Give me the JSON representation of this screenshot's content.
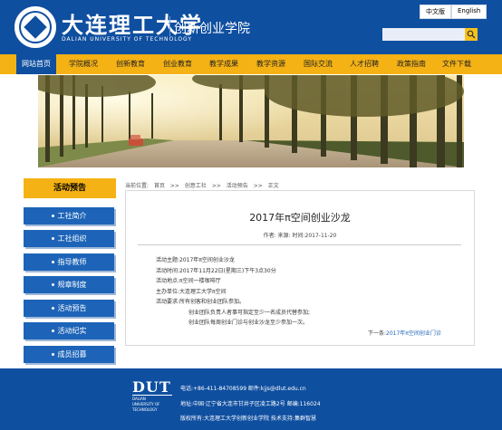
{
  "header": {
    "logo_cn": "大连理工大学",
    "logo_en": "DALIAN UNIVERSITY OF TECHNOLOGY",
    "site_name": "创新创业学院",
    "lang": [
      "中文版",
      "English"
    ],
    "search_placeholder": ""
  },
  "nav": {
    "items": [
      "网站首页",
      "学院概况",
      "创新教育",
      "创业教育",
      "教学成果",
      "教学资源",
      "国际交流",
      "人才招聘",
      "政策指南",
      "文件下载"
    ],
    "active": "网站首页"
  },
  "sidebar": {
    "title": "活动预告",
    "items": [
      "工社简介",
      "工社组织",
      "指导教师",
      "规章制度",
      "活动预告",
      "活动纪实",
      "成员招募"
    ]
  },
  "breadcrumb": {
    "prefix": "当前位置:",
    "items": [
      "首页",
      ">>",
      "创意工社",
      ">>",
      "活动预告",
      ">>",
      "正文"
    ]
  },
  "article": {
    "title": "2017年π空间创业沙龙",
    "meta": "作者:   来源:   时间:2017-11-20",
    "lines": [
      "活动主题:2017年π空间创业沙龙",
      "活动时间:2017年11月22日(星期三)下午3点30分",
      "活动地点:π空间一楼咖啡厅",
      "主办单位:大连理工大学π空间",
      "活动要求:所有创客和创业团队参加。",
      "创业团队负责人者事可指定至少一名成员代替参加;",
      "创业团队每周创业门诊与创业沙龙至少参加一次。"
    ],
    "next_label": "下一条:",
    "next_link": "2017年π空间创业门诊"
  },
  "footer": {
    "logo_big": "DUT",
    "logo_small_1": "DALIAN",
    "logo_small_2": "UNIVERSITY OF",
    "logo_small_3": "TECHNOLOGY",
    "line1": "电话:+86-411-84708599  邮件:kjjs@dlut.edu.cn",
    "line2": "地址:中国·辽宁省大连市甘井子区凌工路2号  邮编:116024",
    "line3": "版权所有:大连理工大学创新创业学院  技术支持:集群智慧"
  },
  "colors": {
    "primary_blue": "#0f4fa0",
    "accent_yellow": "#f5b214",
    "side_blue": "#1d64b8"
  }
}
